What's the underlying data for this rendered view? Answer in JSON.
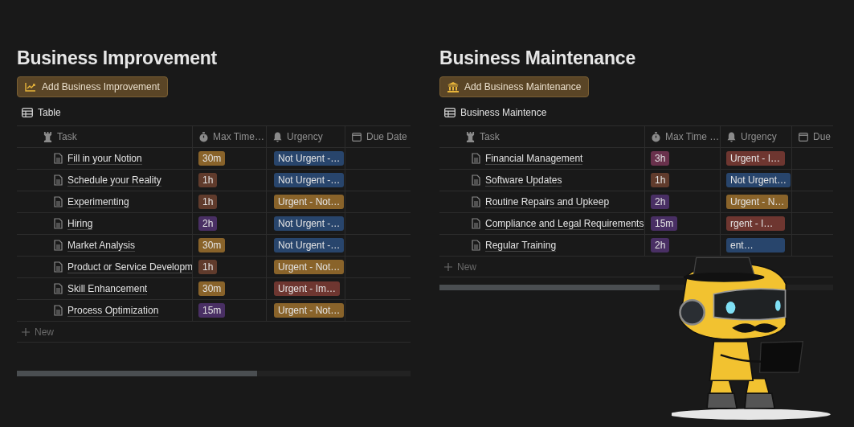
{
  "panels": [
    {
      "title": "Business Improvement",
      "button": {
        "label": "Add Business Improvement"
      },
      "view": {
        "label": "Table"
      },
      "columns": [
        {
          "label": "Task"
        },
        {
          "label": "Max Time…"
        },
        {
          "label": "Urgency"
        },
        {
          "label": "Due Date"
        }
      ],
      "rows": [
        {
          "task": "Fill in your Notion",
          "time": {
            "label": "30m",
            "color": "#89632a"
          },
          "urgency": {
            "label": "Not Urgent -…",
            "color": "#28456c"
          }
        },
        {
          "task": "Schedule your Reality",
          "time": {
            "label": "1h",
            "color": "#603b2c"
          },
          "urgency": {
            "label": "Not Urgent -…",
            "color": "#28456c"
          }
        },
        {
          "task": "Experimenting",
          "time": {
            "label": "1h",
            "color": "#603b2c"
          },
          "urgency": {
            "label": "Urgent - Not…",
            "color": "#89632a"
          }
        },
        {
          "task": "Hiring",
          "time": {
            "label": "2h",
            "color": "#492f64"
          },
          "urgency": {
            "label": "Not Urgent -…",
            "color": "#28456c"
          }
        },
        {
          "task": "Market Analysis",
          "time": {
            "label": "30m",
            "color": "#89632a"
          },
          "urgency": {
            "label": "Not Urgent -…",
            "color": "#28456c"
          }
        },
        {
          "task": "Product or Service Developm",
          "time": {
            "label": "1h",
            "color": "#603b2c"
          },
          "urgency": {
            "label": "Urgent - Not…",
            "color": "#89632a"
          }
        },
        {
          "task": "Skill Enhancement",
          "time": {
            "label": "30m",
            "color": "#89632a"
          },
          "urgency": {
            "label": "Urgent - Im…",
            "color": "#6e3630"
          }
        },
        {
          "task": "Process Optimization",
          "time": {
            "label": "15m",
            "color": "#492f64"
          },
          "urgency": {
            "label": "Urgent - Not…",
            "color": "#89632a"
          }
        }
      ],
      "new_label": "New"
    },
    {
      "title": "Business Maintenance",
      "button": {
        "label": "Add Business Maintenance"
      },
      "view": {
        "label": "Business Maintence"
      },
      "columns": [
        {
          "label": "Task"
        },
        {
          "label": "Max Time …"
        },
        {
          "label": "Urgency"
        },
        {
          "label": "Due"
        }
      ],
      "rows": [
        {
          "task": "Financial Management",
          "time": {
            "label": "3h",
            "color": "#69314c"
          },
          "urgency": {
            "label": "Urgent - I…",
            "color": "#6e3630"
          }
        },
        {
          "task": "Software Updates",
          "time": {
            "label": "1h",
            "color": "#603b2c"
          },
          "urgency": {
            "label": "Not Urgent…",
            "color": "#28456c"
          }
        },
        {
          "task": "Routine Repairs and Upkeep",
          "time": {
            "label": "2h",
            "color": "#492f64"
          },
          "urgency": {
            "label": "Urgent - N…",
            "color": "#89632a"
          }
        },
        {
          "task": "Compliance and Legal Requirements",
          "time": {
            "label": "15m",
            "color": "#492f64"
          },
          "urgency": {
            "label": "rgent - I…",
            "color": "#6e3630"
          }
        },
        {
          "task": "Regular Training",
          "time": {
            "label": "2h",
            "color": "#492f64"
          },
          "urgency": {
            "label": "ent…",
            "color": "#28456c"
          }
        }
      ],
      "new_label": "New"
    }
  ]
}
